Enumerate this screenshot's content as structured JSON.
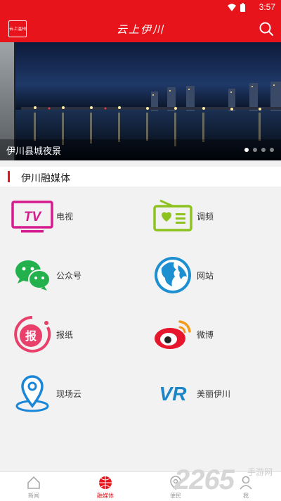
{
  "status_bar": {
    "time": "3:57"
  },
  "header": {
    "logo_text": "云上温州",
    "title": "云上伊川"
  },
  "banner": {
    "caption": "伊川县城夜景",
    "dot_count": 4,
    "active_dot": 0
  },
  "section": {
    "title": "伊川融媒体"
  },
  "tiles": [
    {
      "label": "电视",
      "icon": "tv-icon"
    },
    {
      "label": "调频",
      "icon": "radio-icon"
    },
    {
      "label": "公众号",
      "icon": "wechat-icon"
    },
    {
      "label": "网站",
      "icon": "globe-icon"
    },
    {
      "label": "报纸",
      "icon": "newspaper-icon"
    },
    {
      "label": "微博",
      "icon": "weibo-icon"
    },
    {
      "label": "现场云",
      "icon": "location-pin-icon"
    },
    {
      "label": "美丽伊川",
      "icon": "vr-icon"
    }
  ],
  "tabbar": {
    "items": [
      {
        "label": "新闻",
        "icon": "home-icon"
      },
      {
        "label": "融媒体",
        "icon": "globe-icon"
      },
      {
        "label": "便民",
        "icon": "location-icon"
      },
      {
        "label": "我",
        "icon": "user-icon"
      }
    ],
    "active": 1
  },
  "watermark": {
    "number": "2265",
    "text": "手游网"
  },
  "colors": {
    "brand_red": "#e8141b",
    "tv_magenta": "#d41c8e",
    "radio_green": "#8dc21f",
    "wechat_green": "#22b14c",
    "globe_blue": "#1e8fd0",
    "weibo_red": "#e6162d",
    "pin_blue": "#1a86d8"
  }
}
